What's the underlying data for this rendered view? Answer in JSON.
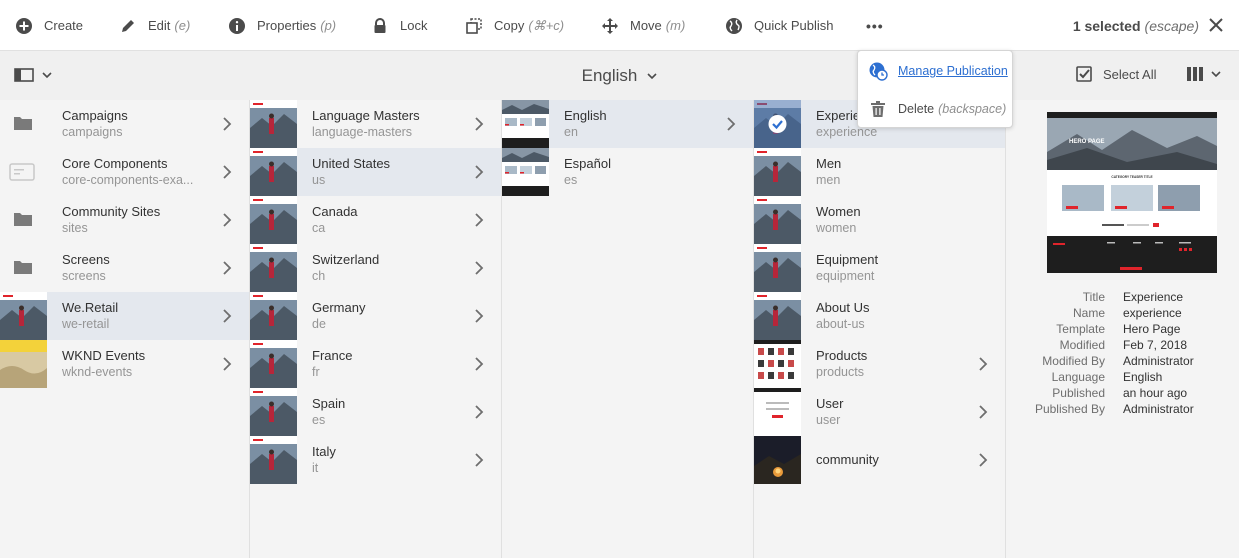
{
  "toolbar": {
    "create": "Create",
    "edit": "Edit",
    "edit_shortcut": "(e)",
    "properties": "Properties",
    "properties_shortcut": "(p)",
    "lock": "Lock",
    "copy": "Copy",
    "copy_shortcut": "(⌘+c)",
    "move": "Move",
    "move_shortcut": "(m)",
    "quick_publish": "Quick Publish",
    "more": "•••",
    "selected_count": "1 selected",
    "selected_escape": "(escape)"
  },
  "header": {
    "title": "English",
    "select_all": "Select All"
  },
  "popover": {
    "manage_publication": "Manage Publication",
    "delete": "Delete",
    "delete_shortcut": "(backspace)"
  },
  "columns": {
    "col1": [
      {
        "title": "Campaigns",
        "name": "campaigns",
        "thumb": "folder"
      },
      {
        "title": "Core Components",
        "name": "core-components-exa...",
        "thumb": "component"
      },
      {
        "title": "Community Sites",
        "name": "sites",
        "thumb": "folder"
      },
      {
        "title": "Screens",
        "name": "screens",
        "thumb": "folder"
      },
      {
        "title": "We.Retail",
        "name": "we-retail",
        "thumb": "site",
        "active": true
      },
      {
        "title": "WKND Events",
        "name": "wknd-events",
        "thumb": "wknd"
      }
    ],
    "col2": [
      {
        "title": "Language Masters",
        "name": "language-masters"
      },
      {
        "title": "United States",
        "name": "us",
        "active": true
      },
      {
        "title": "Canada",
        "name": "ca"
      },
      {
        "title": "Switzerland",
        "name": "ch"
      },
      {
        "title": "Germany",
        "name": "de"
      },
      {
        "title": "France",
        "name": "fr"
      },
      {
        "title": "Spain",
        "name": "es"
      },
      {
        "title": "Italy",
        "name": "it"
      }
    ],
    "col3": [
      {
        "title": "English",
        "name": "en",
        "active": true
      },
      {
        "title": "Español",
        "name": "es"
      }
    ],
    "col4": [
      {
        "title": "Experience",
        "name": "experience",
        "selected": true
      },
      {
        "title": "Men",
        "name": "men"
      },
      {
        "title": "Women",
        "name": "women"
      },
      {
        "title": "Equipment",
        "name": "equipment"
      },
      {
        "title": "About Us",
        "name": "about-us"
      },
      {
        "title": "Products",
        "name": "products",
        "has_children": true
      },
      {
        "title": "User",
        "name": "user",
        "has_children": true
      },
      {
        "title": "community",
        "name": "",
        "has_children": true
      }
    ]
  },
  "preview": {
    "hero_text": "HERO PAGE",
    "section_text": "CATEGORY TEASER TITLE"
  },
  "properties": [
    {
      "label": "Title",
      "value": "Experience"
    },
    {
      "label": "Name",
      "value": "experience"
    },
    {
      "label": "Template",
      "value": "Hero Page"
    },
    {
      "label": "Modified",
      "value": "Feb 7, 2018"
    },
    {
      "label": "Modified By",
      "value": "Administrator"
    },
    {
      "label": "Language",
      "value": "English"
    },
    {
      "label": "Published",
      "value": "an hour ago"
    },
    {
      "label": "Published By",
      "value": "Administrator"
    }
  ],
  "colors": {
    "accent": "#2d6fd1",
    "active_row": "#e4e8ee",
    "brand_red": "#e0242b"
  }
}
